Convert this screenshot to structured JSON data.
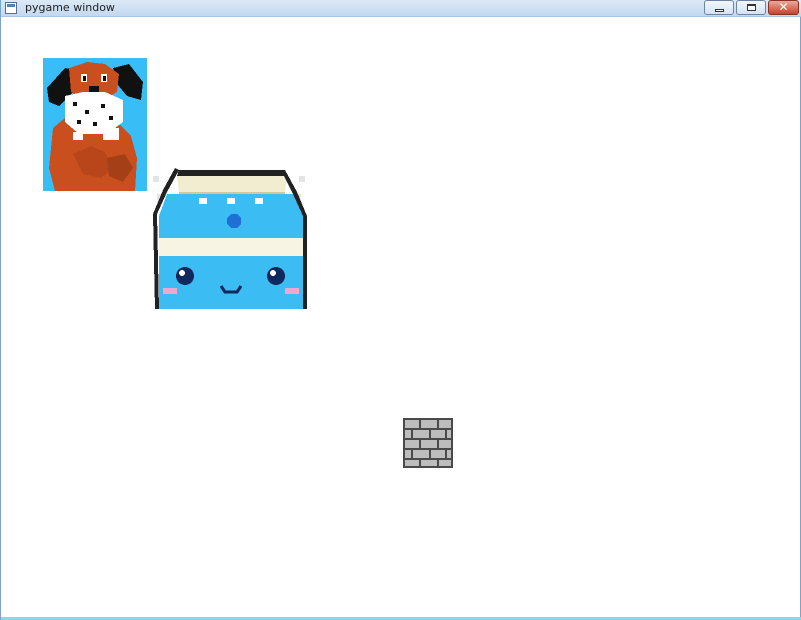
{
  "window": {
    "title": "pygame window",
    "accent_color": "#7da2ce"
  },
  "titlebar_buttons": {
    "minimize_icon": "minimize-icon",
    "maximize_icon": "maximize-icon",
    "close_icon": "close-icon",
    "close_glyph": "✕"
  },
  "sprites": {
    "dog": {
      "name": "duck-hunt-dog-sprite",
      "bg_color": "#39bdf7",
      "body_color": "#c9501e"
    },
    "milk": {
      "name": "milk-carton-sprite",
      "carton_color": "#3bbcf2"
    },
    "brick": {
      "name": "brick-block-sprite",
      "color": "#bdbdbd"
    }
  }
}
